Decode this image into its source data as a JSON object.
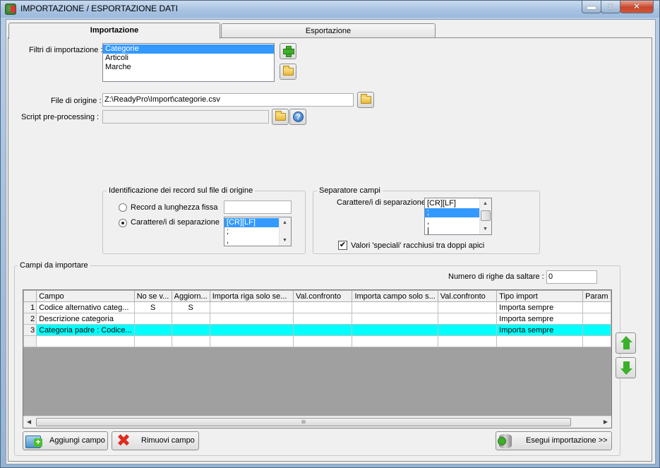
{
  "window": {
    "title": "IMPORTAZIONE / ESPORTAZIONE DATI",
    "minimize_glyph": "▬",
    "maximize_glyph": "□",
    "close_glyph": "✕"
  },
  "tabs": [
    {
      "label": "Importazione",
      "active": true
    },
    {
      "label": "Esportazione",
      "active": false
    }
  ],
  "import_filters": {
    "label": "Filtri di importazione :",
    "items": [
      "Categorie",
      "Articoli",
      "Marche"
    ],
    "selected": "Categorie"
  },
  "source_file": {
    "label": "File di origine :",
    "value": "Z:\\ReadyPro\\Import\\categorie.csv"
  },
  "preprocessing_script": {
    "label": "Script pre-processing :",
    "value": ""
  },
  "record_identification": {
    "title": "Identificazione dei record sul file di origine",
    "fixed_length_label": "Record a lunghezza fissa",
    "fixed_length_value": "",
    "separator_label": "Carattere/i di separazione",
    "separator_options": [
      "[CR][LF]",
      ";",
      ","
    ],
    "separator_selected": "[CR][LF]",
    "selected_mode": "separator"
  },
  "field_separator": {
    "title": "Separatore campi",
    "label": "Carattere/i di separazione",
    "options": [
      "[CR][LF]",
      ";",
      ",",
      "|"
    ],
    "selected": ";",
    "quoted_special_label": "Valori 'speciali' racchiusi tra doppi apici",
    "quoted_special_checked": true,
    "check_glyph": "✔"
  },
  "fields_to_import": {
    "title": "Campi da importare",
    "skip_rows_label": "Numero di righe da saltare :",
    "skip_rows_value": "0",
    "columns": [
      "Campo",
      "No se v...",
      "Aggiorn...",
      "Importa riga solo se...",
      "Val.confronto",
      "Importa campo solo s...",
      "Val.confronto",
      "Tipo import",
      "Param"
    ],
    "rows": [
      {
        "num": "1",
        "cells": [
          "Codice alternativo categ...",
          "S",
          "S",
          "",
          "",
          "",
          "",
          "Importa sempre",
          ""
        ]
      },
      {
        "num": "2",
        "cells": [
          "Descrizione categoria",
          "",
          "",
          "",
          "",
          "",
          "",
          "Importa sempre",
          ""
        ]
      },
      {
        "num": "3",
        "cells": [
          "Categoria padre : Codice...",
          "",
          "",
          "",
          "",
          "",
          "",
          "Importa sempre",
          ""
        ],
        "highlighted": true
      }
    ]
  },
  "buttons": {
    "add_field": "Aggiungi campo",
    "remove_field": "Rimuovi campo",
    "run_import": "Esegui importazione >>",
    "help_glyph": "?",
    "remove_glyph": "✖"
  },
  "scroll": {
    "up_glyph": "▲",
    "down_glyph": "▼",
    "left_glyph": "◀",
    "right_glyph": "▶",
    "grip_glyph": "III"
  }
}
